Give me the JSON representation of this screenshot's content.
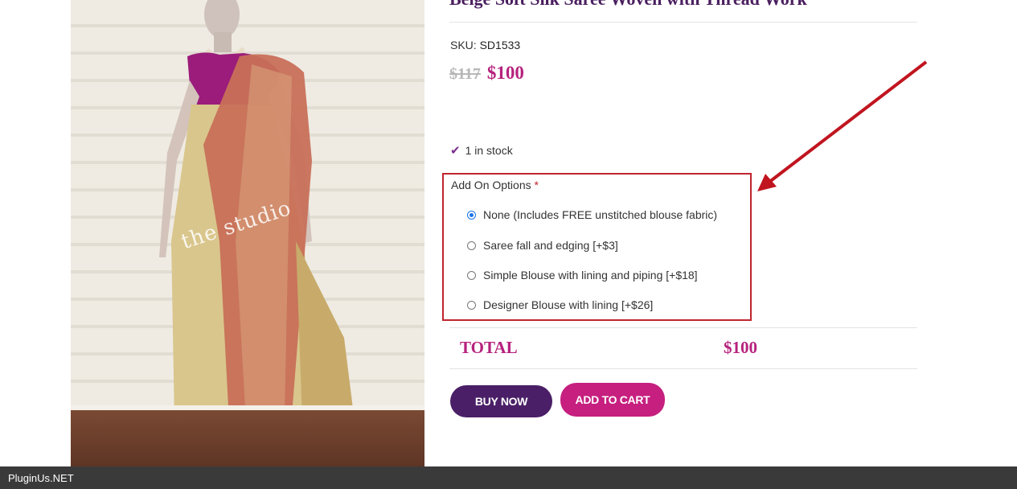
{
  "product": {
    "title": "Beige Soft Silk Saree Woven with Thread Work",
    "image_watermark": "the studio",
    "sku_label": "SKU:",
    "sku_value": "SD1533",
    "price_old": "$117",
    "price_new": "$100",
    "stock_text": "1 in stock"
  },
  "addons": {
    "label": "Add On Options",
    "required_mark": "*",
    "options": [
      {
        "label": "None (Includes FREE unstitched blouse fabric)",
        "checked": true
      },
      {
        "label": "Saree fall and edging [+$3]",
        "checked": false
      },
      {
        "label": "Simple Blouse with lining and piping [+$18]",
        "checked": false
      },
      {
        "label": "Designer Blouse with lining [+$26]",
        "checked": false
      }
    ]
  },
  "total": {
    "label": "TOTAL",
    "value": "$100"
  },
  "buttons": {
    "buy_now": "BUY NOW",
    "add_to_cart": "ADD TO CART"
  },
  "footer": {
    "brand": "PluginUs.NET"
  },
  "colors": {
    "accent_pink": "#b6227d",
    "accent_purple": "#4a1f67",
    "highlight_red": "#c0252f"
  }
}
